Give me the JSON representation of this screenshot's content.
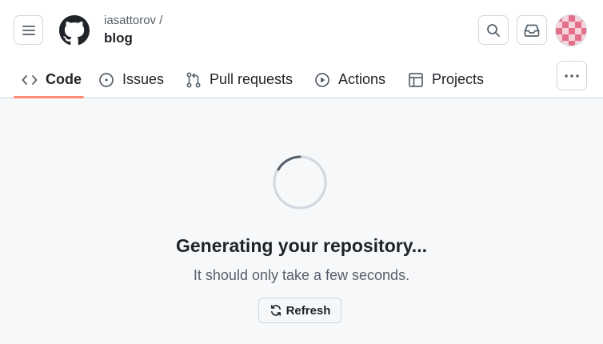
{
  "header": {
    "owner": "iasattorov /",
    "repo": "blog"
  },
  "tabs": [
    {
      "label": "Code",
      "icon": "code-icon",
      "selected": true
    },
    {
      "label": "Issues",
      "icon": "issue-opened-icon",
      "selected": false
    },
    {
      "label": "Pull requests",
      "icon": "git-pull-request-icon",
      "selected": false
    },
    {
      "label": "Actions",
      "icon": "play-icon",
      "selected": false
    },
    {
      "label": "Projects",
      "icon": "table-icon",
      "selected": false
    }
  ],
  "main": {
    "title": "Generating your repository...",
    "subtitle": "It should only take a few seconds.",
    "refresh_label": "Refresh"
  },
  "colors": {
    "accent_underline": "#fd8c73",
    "avatar_primary": "#e26f88",
    "avatar_secondary": "#f6d3db"
  }
}
